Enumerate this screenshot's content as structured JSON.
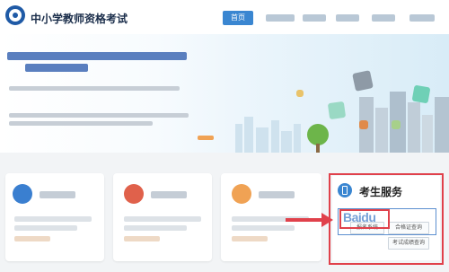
{
  "header": {
    "site_title": "中小学教师资格考试",
    "nav": {
      "home_label": "首页"
    }
  },
  "service_panel": {
    "title": "考生服务",
    "links": [
      "报名系统",
      "合格证查询",
      "考试成绩查询"
    ]
  },
  "overlay": {
    "watermark_text": "Baidu"
  },
  "colors": {
    "accent": "#3a86d1",
    "highlight": "#e0414b",
    "brand": "#1f5aa6"
  }
}
